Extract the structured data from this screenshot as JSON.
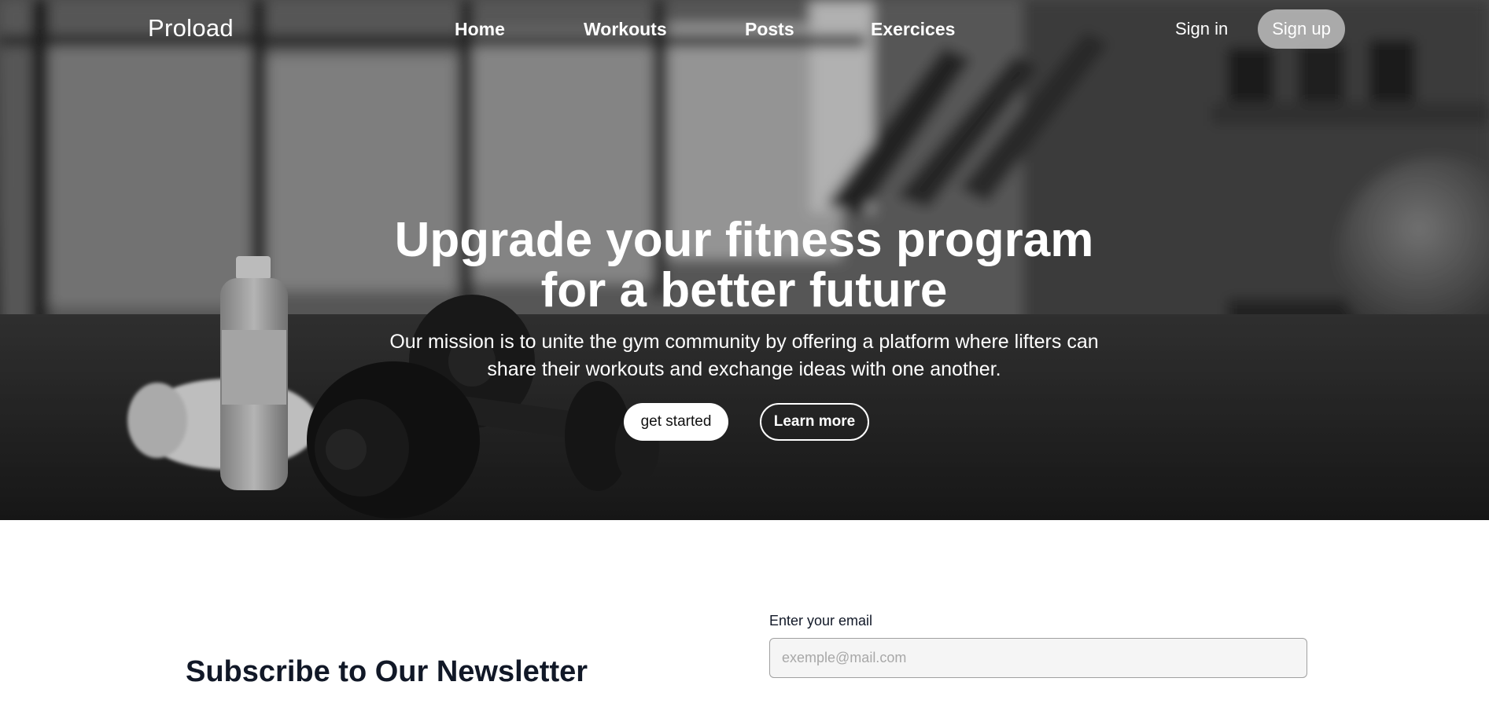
{
  "brand": {
    "name": "Proload"
  },
  "nav": {
    "links": [
      "Home",
      "Workouts",
      "Posts",
      "Exercices"
    ],
    "sign_in": "Sign in",
    "sign_up": "Sign up"
  },
  "hero": {
    "title_line1": "Upgrade your fitness program",
    "title_line2": "for a better future",
    "subtitle_line1": "Our mission is to unite the gym community by offering a platform where lifters can",
    "subtitle_line2": "share their workouts and exchange ideas with one another.",
    "primary_button": "get started",
    "secondary_button": "Learn more"
  },
  "newsletter": {
    "title": "Subscribe to Our Newsletter",
    "email_label": "Enter your email",
    "email_placeholder": "exemple@mail.com",
    "email_value": ""
  },
  "colors": {
    "heading_text": "#111827",
    "signup_bg": "#bebebe"
  }
}
